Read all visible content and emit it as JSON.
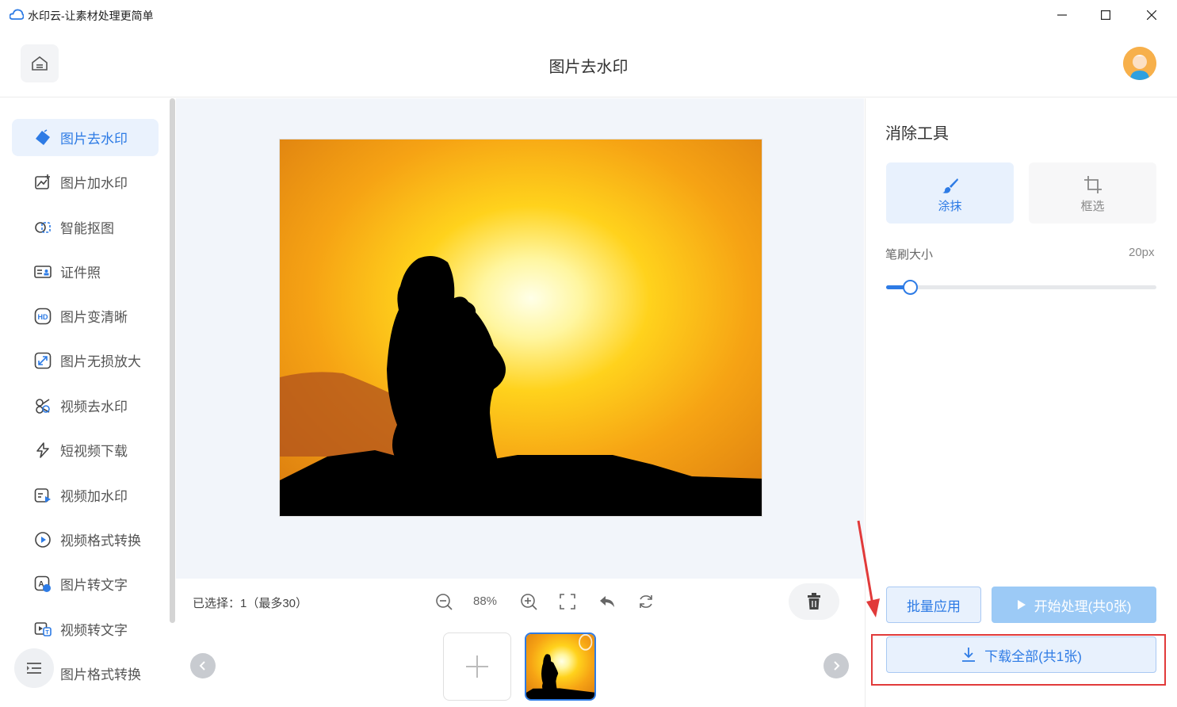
{
  "window": {
    "title": "水印云-让素材处理更简单"
  },
  "header": {
    "title": "图片去水印"
  },
  "sidebar": {
    "items": [
      {
        "label": "图片去水印",
        "icon": "eraser-icon",
        "active": true
      },
      {
        "label": "图片加水印",
        "icon": "image-add-icon"
      },
      {
        "label": "智能抠图",
        "icon": "cutout-icon"
      },
      {
        "label": "证件照",
        "icon": "id-card-icon"
      },
      {
        "label": "图片变清晰",
        "icon": "hd-icon"
      },
      {
        "label": "图片无损放大",
        "icon": "enlarge-icon"
      },
      {
        "label": "视频去水印",
        "icon": "video-eraser-icon"
      },
      {
        "label": "短视频下载",
        "icon": "download-link-icon"
      },
      {
        "label": "视频加水印",
        "icon": "video-add-icon"
      },
      {
        "label": "视频格式转换",
        "icon": "play-circle-icon"
      },
      {
        "label": "图片转文字",
        "icon": "image-text-icon"
      },
      {
        "label": "视频转文字",
        "icon": "video-text-icon"
      },
      {
        "label": "图片格式转换",
        "icon": "format-icon"
      }
    ]
  },
  "toolbar": {
    "selected": "已选择：1（最多30）",
    "zoom": "88%"
  },
  "right_panel": {
    "title": "消除工具",
    "tools": [
      {
        "label": "涂抹",
        "icon": "brush-icon",
        "active": true
      },
      {
        "label": "框选",
        "icon": "crop-icon"
      }
    ],
    "brush_label": "笔刷大小",
    "brush_value": "20px",
    "brush_level": 0.09,
    "batch_button": "批量应用",
    "start_button": "开始处理(共0张)",
    "download_button": "下载全部(共1张)"
  },
  "colors": {
    "accent": "#2d7be5",
    "highlight": "#e13a3a"
  }
}
